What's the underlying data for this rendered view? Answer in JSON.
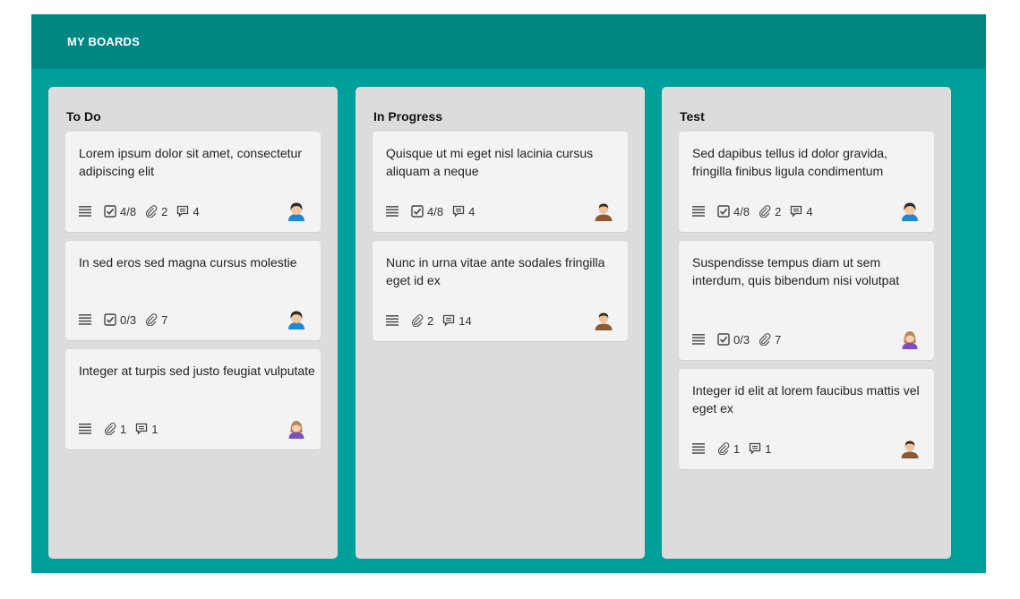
{
  "header": {
    "title": "MY BOARDS"
  },
  "colors": {
    "board_bg": "#00a09a",
    "header_bg": "#008683",
    "column_bg": "#dcdcdc",
    "card_bg": "#f3f3f3"
  },
  "columns": [
    {
      "title": "To Do",
      "cards": [
        {
          "title": "Lorem ipsum dolor sit amet, consectetur adipiscing elit",
          "checklist": "4/8",
          "attachments": "2",
          "comments": "4",
          "avatar": "avatar-blue-dark-hair"
        },
        {
          "title": "In sed eros sed magna cursus molestie",
          "checklist": "0/3",
          "attachments": "7",
          "avatar": "avatar-blue-dark-hair"
        },
        {
          "title": "Integer at turpis sed justo feugiat vulputate",
          "attachments": "1",
          "comments": "1",
          "avatar": "avatar-purple-woman"
        }
      ]
    },
    {
      "title": "In Progress",
      "cards": [
        {
          "title": "Quisque ut mi eget nisl lacinia cursus aliquam a neque",
          "checklist": "4/8",
          "comments": "4",
          "avatar": "avatar-brown-man"
        },
        {
          "title": "Nunc in urna vitae ante sodales fringilla eget id ex",
          "attachments": "2",
          "comments": "14",
          "avatar": "avatar-brown-man"
        }
      ]
    },
    {
      "title": "Test",
      "cards": [
        {
          "title": "Sed dapibus tellus id dolor gravida, fringilla finibus ligula condimentum",
          "checklist": "4/8",
          "attachments": "2",
          "comments": "4",
          "avatar": "avatar-blue-dark-hair"
        },
        {
          "title": "Suspendisse tempus diam ut sem interdum, quis bibendum nisi volutpat",
          "checklist": "0/3",
          "attachments": "7",
          "avatar": "avatar-purple-woman"
        },
        {
          "title": "Integer id elit at lorem faucibus mattis vel eget ex",
          "attachments": "1",
          "comments": "1",
          "avatar": "avatar-brown-man"
        }
      ]
    }
  ]
}
